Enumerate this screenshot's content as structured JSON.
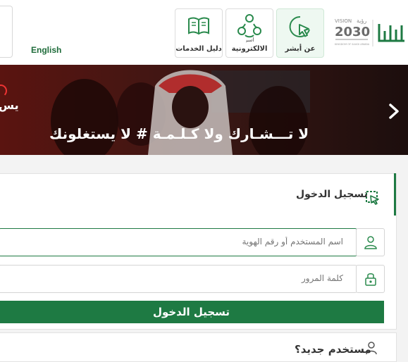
{
  "header": {
    "language_link": "English",
    "tiles": [
      {
        "name": "about-absher",
        "label": "عن أبشر",
        "icon": "cursor-click-icon",
        "active": true
      },
      {
        "name": "e-services",
        "label": "الالكترونية",
        "icon": "people-network-icon",
        "active": false
      },
      {
        "name": "services-guide",
        "label": "دليل الخدمات",
        "icon": "open-book-icon",
        "active": false
      }
    ],
    "logo": {
      "vision_text": "VISION",
      "vision_year": "2030",
      "vision_arabic": "رؤية",
      "kingdom_text": "KINGDOM OF SAUDI ARABIA",
      "brand": "أبشر"
    }
  },
  "banner": {
    "text": "لا تـــشـارك ولا كـلـمـة # لا يستغلونك",
    "partial_text": "يس",
    "next_icon": "chevron-right-icon"
  },
  "login": {
    "title": "تسجيل الدخول",
    "username_placeholder": "اسم المستخدم أو رقم الهوية",
    "password_placeholder": "كلمة المرور",
    "submit_label": "تسجيل الدخول"
  },
  "new_user": {
    "label": "مستخدم جديد؟"
  },
  "colors": {
    "brand_green": "#1e7a43",
    "banner_bg": "#3a1512"
  }
}
